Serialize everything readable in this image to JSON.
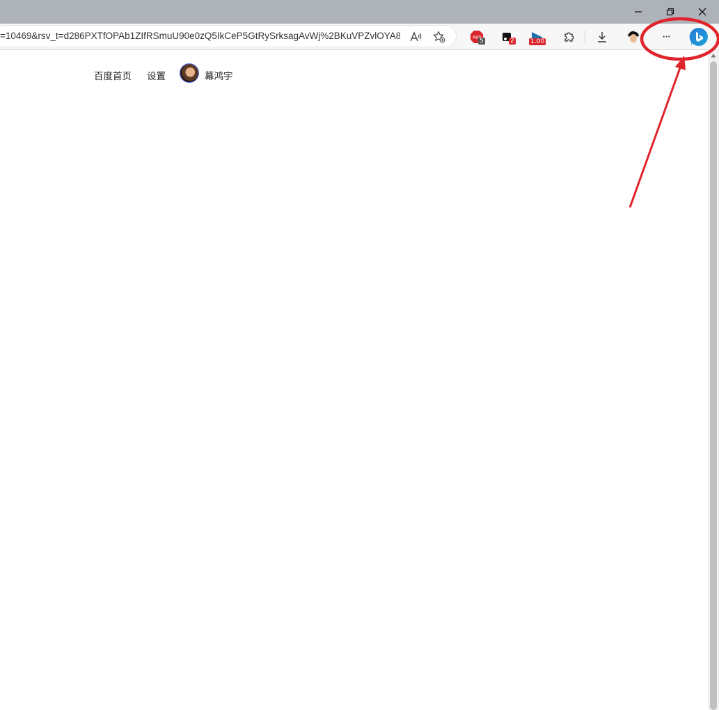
{
  "browser": {
    "url": "=10469&rsv_t=d286PXTfOPAb1ZIfRSmuU90e0zQ5IkCeP5GtRySrksagAvWj%2BKuVPZvlOYA8...",
    "extensions": {
      "abp_badge": "5",
      "ext2_badge": "2",
      "speed_badge": "1.00"
    },
    "more_label": "···"
  },
  "page": {
    "nav": {
      "home_label": "百度首页",
      "settings_label": "设置",
      "username": "幕鸿宇"
    }
  },
  "colors": {
    "annotation_red": "#e0242c",
    "titlebar": "#aeb3ba",
    "baidu_blue": "#4e6ef2"
  }
}
